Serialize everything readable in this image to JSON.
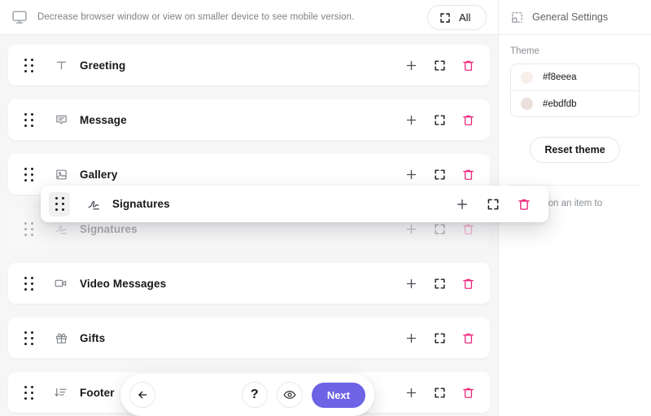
{
  "notice": {
    "icon": "monitor-icon",
    "text": "Decrease browser window or view on smaller device to see mobile version.",
    "all_button": {
      "label": "All",
      "icon": "expand-icon"
    }
  },
  "list": {
    "row_actions": {
      "add": "add-icon",
      "expand": "expand-icon",
      "delete": "trash-icon"
    },
    "items": [
      {
        "label": "Greeting",
        "icon": "text-t-icon",
        "state": "normal"
      },
      {
        "label": "Message",
        "icon": "message-box-icon",
        "state": "normal"
      },
      {
        "label": "Gallery",
        "icon": "image-icon",
        "state": "normal"
      },
      {
        "label": "Signatures",
        "icon": "signature-icon",
        "state": "ghost"
      },
      {
        "label": "Video Messages",
        "icon": "video-camera-icon",
        "state": "normal"
      },
      {
        "label": "Gifts",
        "icon": "gift-icon",
        "state": "normal"
      },
      {
        "label": "Footer",
        "icon": "sort-desc-icon",
        "state": "normal"
      }
    ]
  },
  "drag_card": {
    "label": "Signatures",
    "icon": "signature-icon"
  },
  "toolbar": {
    "back_icon": "arrow-left-icon",
    "help_label": "?",
    "preview_icon": "eye-icon",
    "next_label": "Next",
    "next_color": "#6c63e5"
  },
  "sidebar": {
    "title": "General Settings",
    "title_icon": "component-icon",
    "theme_label": "Theme",
    "swatches": [
      {
        "value": "#f8eeea",
        "color": "#f8eeea"
      },
      {
        "value": "#ebdfdb",
        "color": "#ebdfdb"
      }
    ],
    "reset_label": "Reset theme",
    "hint_text": "or tap on an item to"
  },
  "colors": {
    "accent_pink": "#ec2a7e",
    "accent_purple": "#6c63e5",
    "page_bg": "#f6f6f7",
    "card_bg": "#ffffff"
  }
}
